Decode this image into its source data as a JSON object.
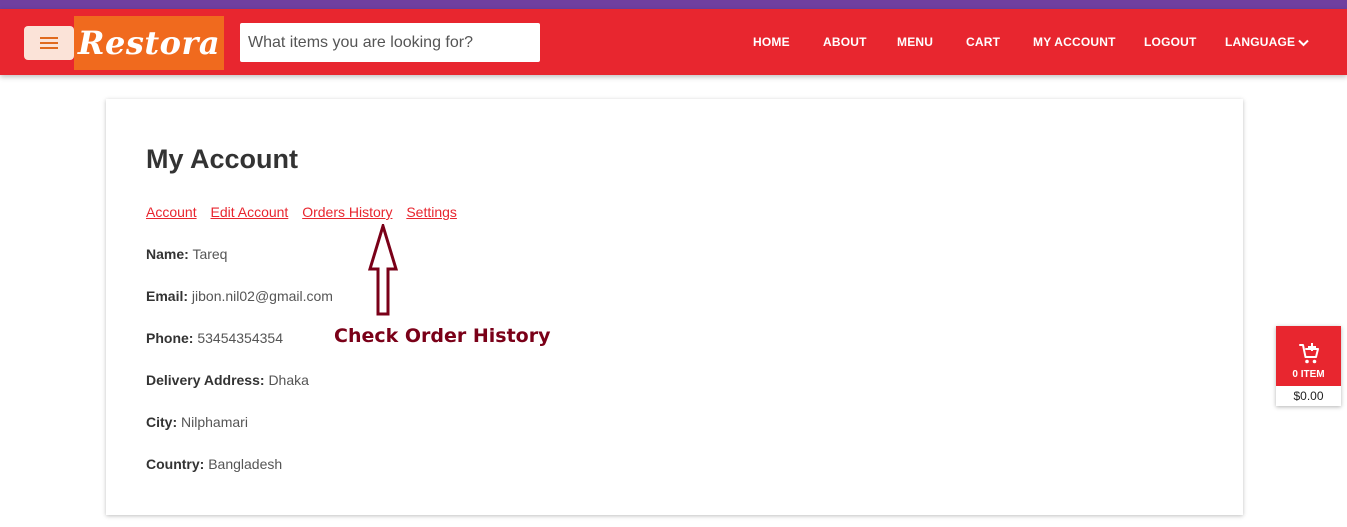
{
  "header": {
    "logo_text": "Restora",
    "search_placeholder": "What items you are looking for?",
    "nav": [
      "HOME",
      "ABOUT",
      "MENU",
      "CART",
      "MY ACCOUNT",
      "LOGOUT",
      "LANGUAGE"
    ],
    "colors": {
      "navbar": "#e8262f",
      "topstrip": "#6f3fa0",
      "logo_bg": "#f06a1e"
    }
  },
  "account": {
    "title": "My Account",
    "tabs": [
      "Account",
      "Edit Account",
      "Orders History",
      "Settings"
    ],
    "fields": [
      {
        "label": "Name:",
        "value": "Tareq"
      },
      {
        "label": "Email:",
        "value": "jibon.nil02@gmail.com"
      },
      {
        "label": "Phone:",
        "value": "53454354354"
      },
      {
        "label": "Delivery Address:",
        "value": "Dhaka"
      },
      {
        "label": "City:",
        "value": "Nilphamari"
      },
      {
        "label": "Country:",
        "value": "Bangladesh"
      }
    ]
  },
  "annotation": {
    "text": "Check Order History"
  },
  "cart_widget": {
    "count_label": "0 ITEM",
    "total": "$0.00",
    "icon": "cart-plus-icon"
  }
}
